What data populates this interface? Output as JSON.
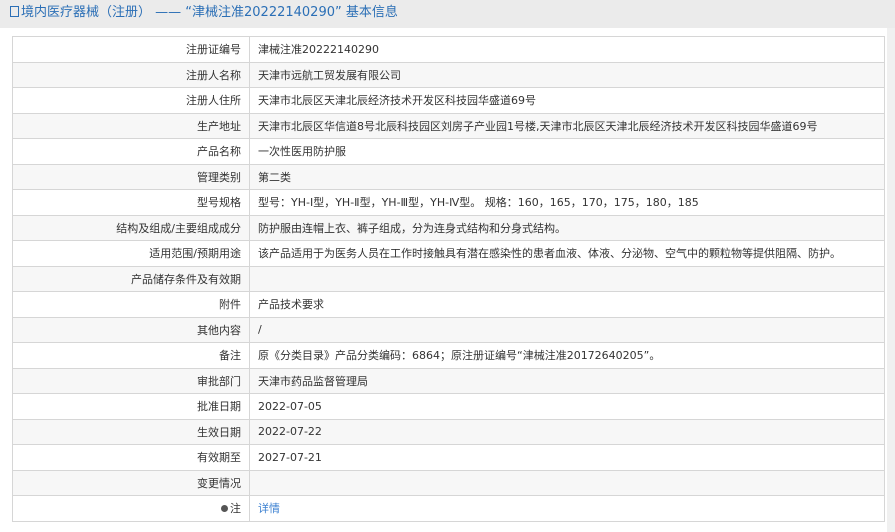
{
  "header": {
    "title": "境内医疗器械（注册） —— “津械注准20222140290” 基本信息"
  },
  "rows": [
    {
      "label": "注册证编号",
      "value": "津械注准20222140290"
    },
    {
      "label": "注册人名称",
      "value": "天津市远航工贸发展有限公司"
    },
    {
      "label": "注册人住所",
      "value": "天津市北辰区天津北辰经济技术开发区科技园华盛道69号"
    },
    {
      "label": "生产地址",
      "value": "天津市北辰区华信道8号北辰科技园区刘房子产业园1号楼,天津市北辰区天津北辰经济技术开发区科技园华盛道69号"
    },
    {
      "label": "产品名称",
      "value": "一次性医用防护服"
    },
    {
      "label": "管理类别",
      "value": "第二类"
    },
    {
      "label": "型号规格",
      "value": "型号：YH-Ⅰ型，YH-Ⅱ型，YH-Ⅲ型，YH-Ⅳ型。 规格：160，165，170，175，180，185"
    },
    {
      "label": "结构及组成/主要组成成分",
      "value": "防护服由连帽上衣、裤子组成，分为连身式结构和分身式结构。"
    },
    {
      "label": "适用范围/预期用途",
      "value": "该产品适用于为医务人员在工作时接触具有潜在感染性的患者血液、体液、分泌物、空气中的颗粒物等提供阻隔、防护。"
    },
    {
      "label": "产品储存条件及有效期",
      "value": ""
    },
    {
      "label": "附件",
      "value": "产品技术要求"
    },
    {
      "label": "其他内容",
      "value": "/"
    },
    {
      "label": "备注",
      "value": "原《分类目录》产品分类编码：6864；原注册证编号“津械注准20172640205”。"
    },
    {
      "label": "审批部门",
      "value": "天津市药品监督管理局"
    },
    {
      "label": "批准日期",
      "value": "2022-07-05"
    },
    {
      "label": "生效日期",
      "value": "2022-07-22"
    },
    {
      "label": "有效期至",
      "value": "2027-07-21"
    },
    {
      "label": "变更情况",
      "value": ""
    }
  ],
  "note": {
    "label": "注",
    "link": "详情"
  }
}
